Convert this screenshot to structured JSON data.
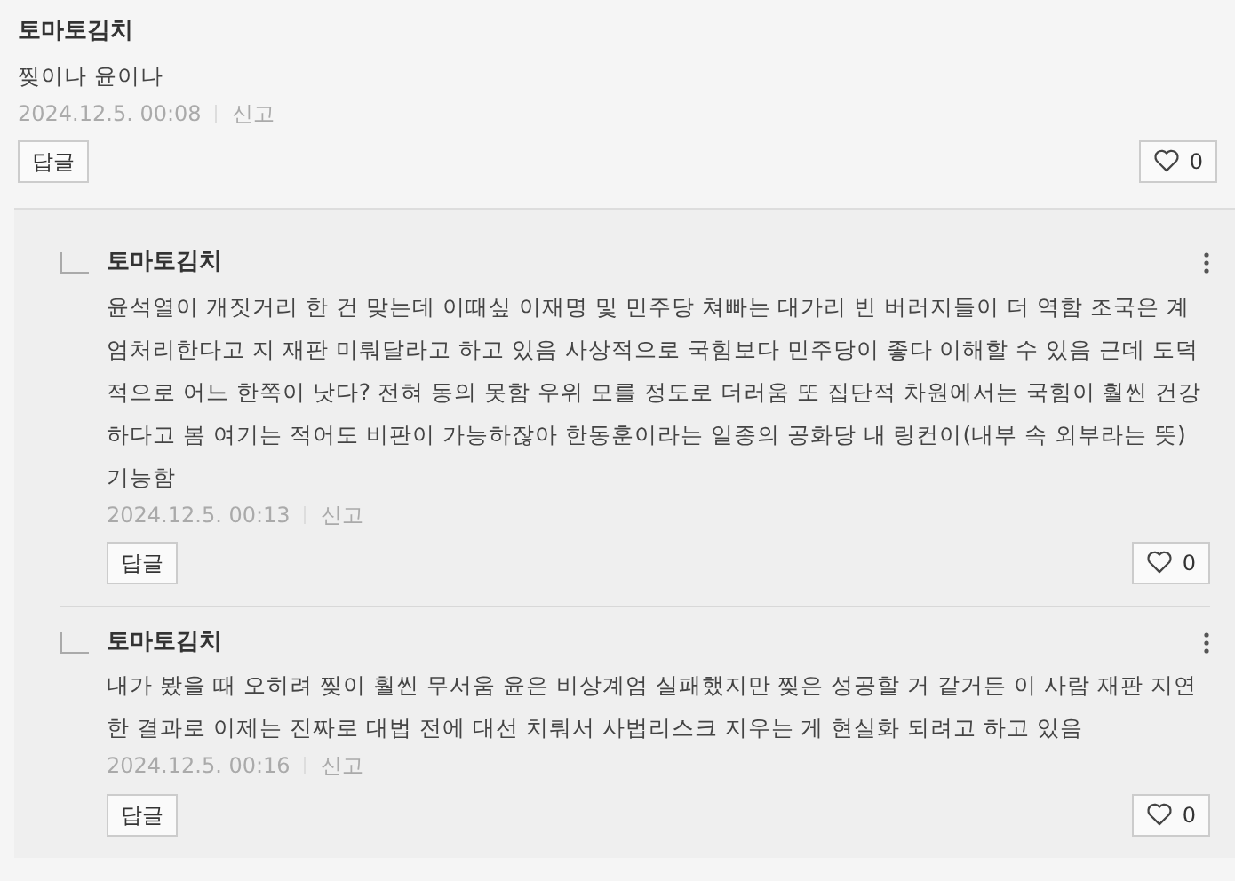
{
  "comment": {
    "author": "토마토김치",
    "text": "찢이나 윤이나",
    "date": "2024.12.5. 00:08",
    "report": "신고",
    "reply_button": "답글",
    "likes": "0"
  },
  "replies": [
    {
      "author": "토마토김치",
      "text": "윤석열이 개짓거리 한 건 맞는데 이때싶 이재명 및 민주당 쳐빠는 대가리 빈 버러지들이 더 역함 조국은 계엄처리한다고 지 재판 미뤄달라고 하고 있음 사상적으로 국힘보다 민주당이 좋다 이해할 수 있음 근데 도덕적으로 어느 한쪽이 낫다? 전혀 동의 못함 우위 모를 정도로 더러움 또 집단적 차원에서는 국힘이 훨씬 건강하다고 봄 여기는 적어도 비판이 가능하잖아 한동훈이라는 일종의 공화당 내 링컨이(내부 속 외부라는 뜻) 기능함",
      "date": "2024.12.5. 00:13",
      "report": "신고",
      "reply_button": "답글",
      "likes": "0"
    },
    {
      "author": "토마토김치",
      "text": "내가 봤을 때 오히려 찢이 훨씬 무서움 윤은 비상계엄 실패했지만 찢은 성공할 거 같거든 이 사람 재판 지연한 결과로 이제는 진짜로 대법 전에 대선 치뤄서 사법리스크 지우는 게 현실화 되려고 하고 있음",
      "date": "2024.12.5. 00:16",
      "report": "신고",
      "reply_button": "답글",
      "likes": "0"
    }
  ]
}
